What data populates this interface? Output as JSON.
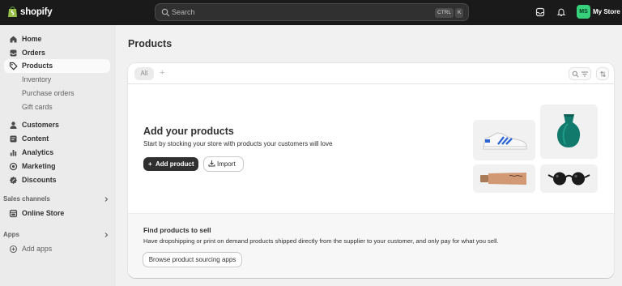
{
  "topbar": {
    "logo_text": "shopify",
    "search_placeholder": "Search",
    "shortcut_ctrl": "CTRL",
    "shortcut_key": "K",
    "avatar_initials": "MS",
    "store_name": "My Store",
    "avatar_color": "#36d17a"
  },
  "sidebar": {
    "items": [
      {
        "label": "Home",
        "icon": "home-icon"
      },
      {
        "label": "Orders",
        "icon": "inbox-icon"
      },
      {
        "label": "Products",
        "icon": "tag-icon",
        "active": true
      },
      {
        "label": "Inventory"
      },
      {
        "label": "Purchase orders"
      },
      {
        "label": "Gift cards"
      },
      {
        "label": "Customers",
        "icon": "person-icon"
      },
      {
        "label": "Content",
        "icon": "content-icon"
      },
      {
        "label": "Analytics",
        "icon": "bar-chart-icon"
      },
      {
        "label": "Marketing",
        "icon": "target-icon"
      },
      {
        "label": "Discounts",
        "icon": "discount-icon"
      }
    ],
    "sales_channels_label": "Sales channels",
    "online_store": {
      "label": "Online Store",
      "icon": "store-icon"
    },
    "apps_label": "Apps",
    "add_apps": {
      "label": "Add apps",
      "icon": "plus-circle-icon"
    }
  },
  "main": {
    "title": "Products",
    "tabs": [
      {
        "label": "All"
      }
    ],
    "add_tab_glyph": "+",
    "empty_state": {
      "title": "Add your products",
      "description": "Start by stocking your store with products your customers will love",
      "primary_button": "Add product",
      "secondary_button": "Import",
      "images": [
        "sneaker-image",
        "vase-image",
        "tube-image",
        "sunglasses-image"
      ]
    },
    "sell": {
      "title": "Find products to sell",
      "description": "Have dropshipping or print on demand products shipped directly from the supplier to your customer, and only pay for what you sell.",
      "button": "Browse product sourcing apps"
    }
  }
}
